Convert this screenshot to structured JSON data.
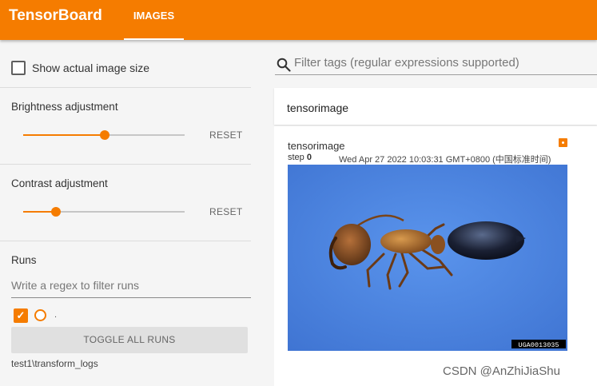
{
  "app": {
    "title": "TensorBoard"
  },
  "nav": {
    "tabs": [
      {
        "label": "IMAGES",
        "active": true
      }
    ]
  },
  "sidebar": {
    "show_actual_size": {
      "label": "Show actual image size",
      "checked": false
    },
    "brightness": {
      "label": "Brightness adjustment",
      "value": 0.5,
      "reset_label": "RESET"
    },
    "contrast": {
      "label": "Contrast adjustment",
      "value": 0.2,
      "reset_label": "RESET"
    },
    "runs": {
      "title": "Runs",
      "filter_placeholder": "Write a regex to filter runs",
      "dot_label": ".",
      "toggle_label": "TOGGLE ALL RUNS",
      "run_name": "test1\\transform_logs"
    }
  },
  "main": {
    "filter": {
      "placeholder": "Filter tags (regular expressions supported)"
    },
    "group": {
      "title": "tensorimage"
    },
    "card": {
      "title": "tensorimage",
      "step_label": "step",
      "step_value": "0",
      "timestamp": "Wed Apr 27 2022 10:03:31 GMT+0800 (中国标准时间)",
      "image_caption": "UGA0013035"
    }
  },
  "watermark": "CSDN @AnZhiJiaShu",
  "colors": {
    "accent": "#f57c00",
    "image_bg": "#4f86e3"
  }
}
